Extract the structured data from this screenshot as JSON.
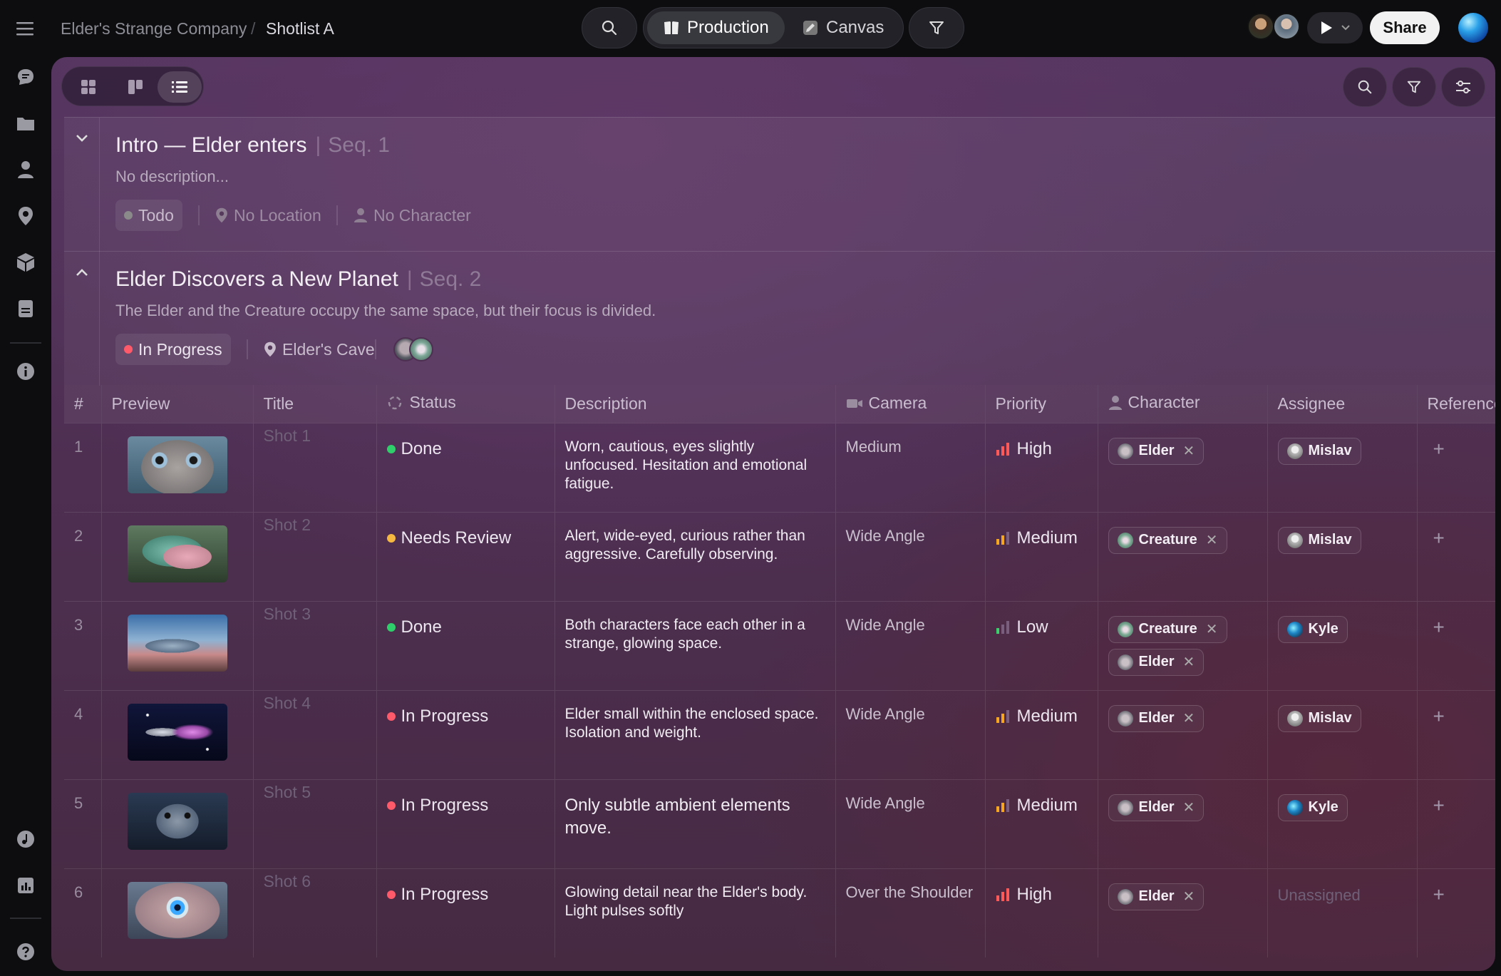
{
  "breadcrumb": {
    "company": "Elder's Strange Company",
    "separator": "/",
    "page": "Shotlist A"
  },
  "topbar": {
    "mode_tabs": [
      {
        "label": "Production",
        "icon": "book-icon",
        "active": true
      },
      {
        "label": "Canvas",
        "icon": "pencil-icon",
        "active": false
      }
    ],
    "share_label": "Share"
  },
  "sidebar": {
    "icons": [
      "menu-icon",
      "chat-icon",
      "folder-icon",
      "person-icon",
      "location-pin-icon",
      "cube-icon",
      "document-icon",
      "info-icon",
      "music-icon",
      "chart-icon",
      "help-icon"
    ]
  },
  "groups": [
    {
      "title": "Intro — Elder enters",
      "seq": "Seq. 1",
      "description": "No description...",
      "status": "Todo",
      "location": "No Location",
      "character": "No Character",
      "expanded": false
    },
    {
      "title": "Elder Discovers a New Planet",
      "seq": "Seq. 2",
      "description": "The Elder and the Creature occupy the same space, but their focus is divided.",
      "status": "In Progress",
      "location": "Elder's Cave",
      "expanded": true
    }
  ],
  "table": {
    "columns": [
      "#",
      "Preview",
      "Title",
      "Status",
      "Description",
      "Camera",
      "Priority",
      "Character",
      "Assignee",
      "Reference"
    ],
    "rows": [
      {
        "num": "1",
        "title": "Shot 1",
        "status": "Done",
        "description": "Worn, cautious, eyes slightly unfocused. Hesitation and emotional fatigue.",
        "camera": "Medium",
        "priority": "High",
        "characters": [
          "Elder"
        ],
        "assignee": "Mislav"
      },
      {
        "num": "2",
        "title": "Shot 2",
        "status": "Needs Review",
        "description": "Alert, wide-eyed, curious rather than aggressive. Carefully observing.",
        "camera": "Wide Angle",
        "priority": "Medium",
        "characters": [
          "Creature"
        ],
        "assignee": "Mislav"
      },
      {
        "num": "3",
        "title": "Shot 3",
        "status": "Done",
        "description": "Both characters face each other in a strange, glowing space.",
        "camera": "Wide Angle",
        "priority": "Low",
        "characters": [
          "Creature",
          "Elder"
        ],
        "assignee": "Kyle"
      },
      {
        "num": "4",
        "title": "Shot 4",
        "status": "In Progress",
        "description": "Elder small within the enclosed space. Isolation and weight.",
        "camera": "Wide Angle",
        "priority": "Medium",
        "characters": [
          "Elder"
        ],
        "assignee": "Mislav"
      },
      {
        "num": "5",
        "title": "Shot 5",
        "status": "In Progress",
        "description": "Only subtle ambient elements move.",
        "camera": "Wide Angle",
        "priority": "Medium",
        "characters": [
          "Elder"
        ],
        "assignee": "Kyle"
      },
      {
        "num": "6",
        "title": "Shot 6",
        "status": "In Progress",
        "description": "Glowing detail near the Elder's body. Light pulses softly",
        "camera": "Over the Shoulder",
        "priority": "High",
        "characters": [
          "Elder"
        ],
        "assignee": "Unassigned"
      }
    ]
  },
  "colors": {
    "done": "#2fd06b",
    "needs_review": "#f5b942",
    "in_progress": "#ff5a6a",
    "todo": "#8a8a8a",
    "priority_high": "#ff5a5a",
    "priority_medium": "#f5a623",
    "priority_low": "#3ecf6f"
  }
}
